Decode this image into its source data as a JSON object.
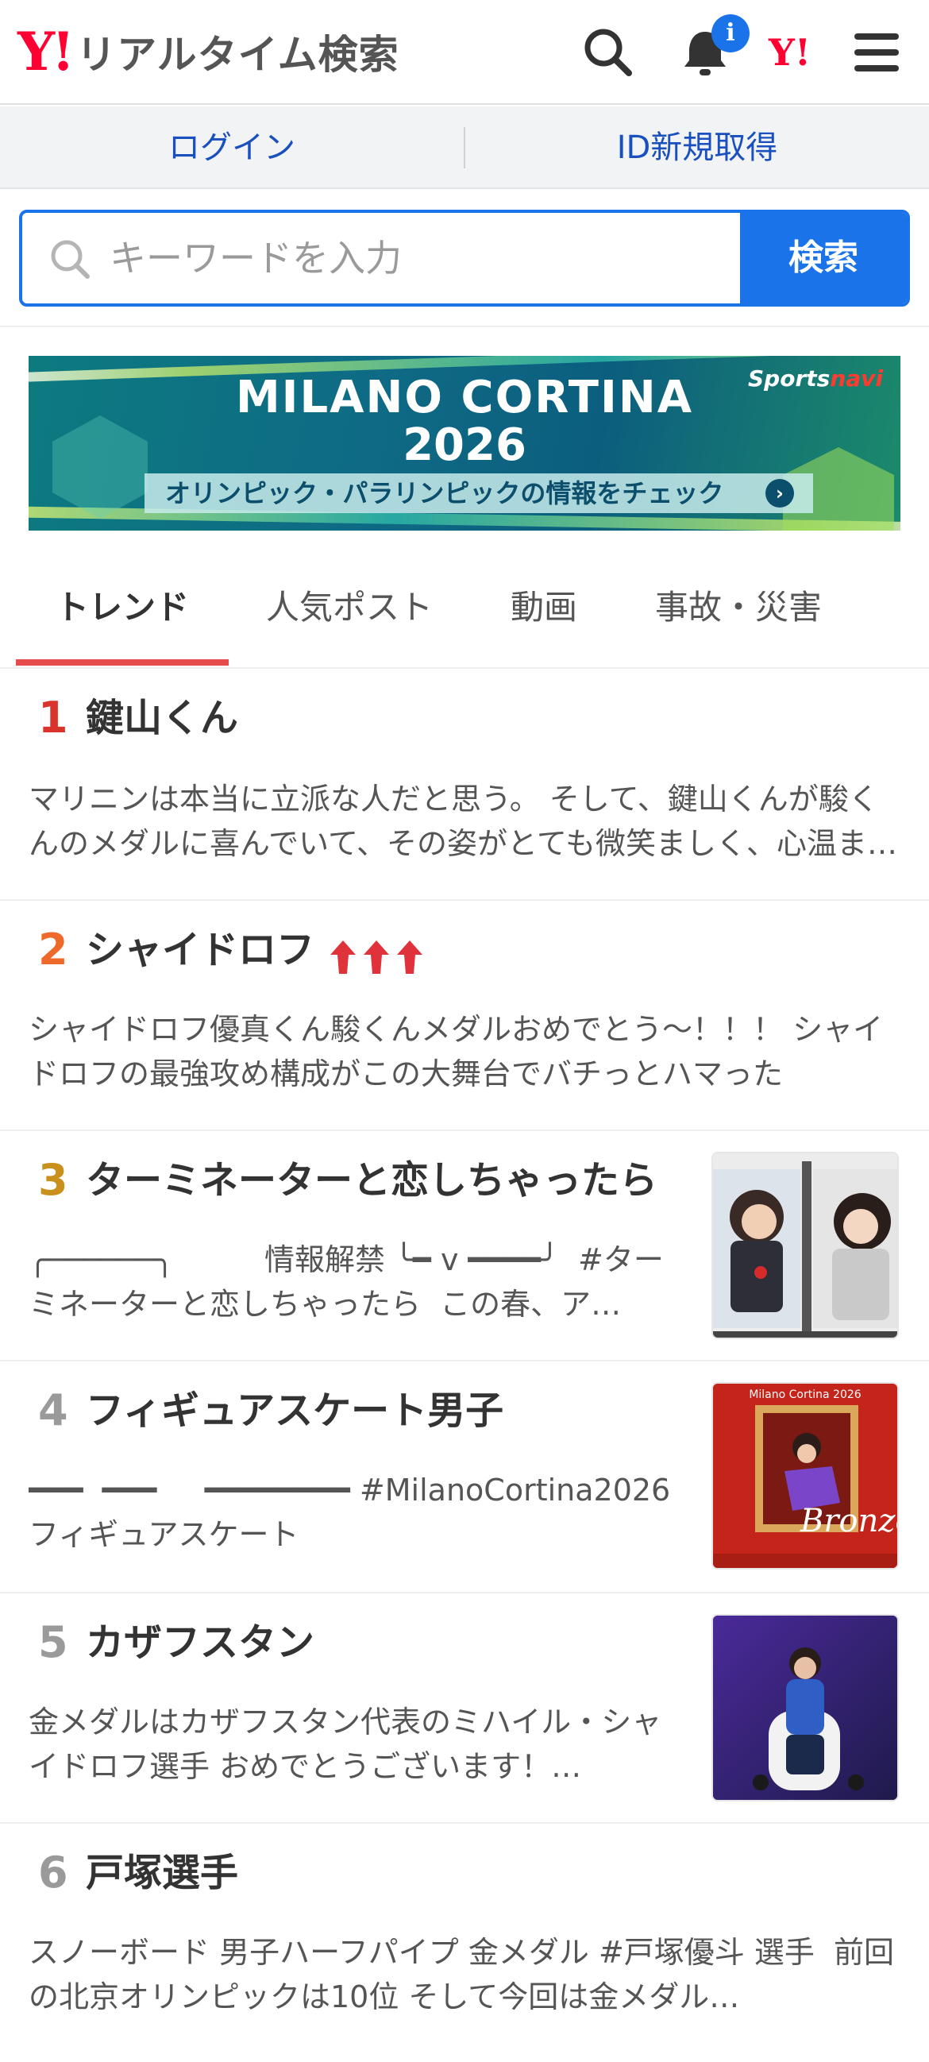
{
  "header": {
    "logo_mark": "Y!",
    "logo_text": "リアルタイム検索",
    "notification_badge": "i",
    "yj_logo": "Y!"
  },
  "loginbar": {
    "login_label": "ログイン",
    "signup_label": "ID新規取得"
  },
  "search": {
    "placeholder": "キーワードを入力",
    "button_label": "検索"
  },
  "banner": {
    "title": "MILANO CORTINA",
    "year": "2026",
    "cta": "オリンピック・パラリンピックの情報をチェック",
    "sponsor_a": "Sports",
    "sponsor_b": "navi"
  },
  "tabs": [
    {
      "label": "トレンド",
      "active": true
    },
    {
      "label": "人気ポスト",
      "active": false
    },
    {
      "label": "動画",
      "active": false
    },
    {
      "label": "事故・災害",
      "active": false
    }
  ],
  "colors": {
    "accent_blue": "#1a73e8",
    "rank1": "#d9342b",
    "rank2": "#ee6a2b",
    "rank3": "#c9901c",
    "rank_other": "#9a9a9a",
    "tab_underline": "#e74c4c"
  },
  "trends": [
    {
      "rank": "1",
      "title": "鍵山くん",
      "desc": "マリニンは本当に立派な人だと思う。 そして、鍵山くんが駿くんのメダルに喜んでいて、その姿がとても微笑ましく、心温まる光景でした。",
      "has_thumb": false
    },
    {
      "rank": "2",
      "title": "シャイドロフ",
      "desc": "シャイドロフ󠄀優真くん󠄀駿くん󠄀メダルおめでとう〜！！！ シャイドロフの最強攻め構成がこの大舞台でバチっとハマった",
      "has_thumb": false,
      "trend_arrows": 3
    },
    {
      "rank": "3",
      "title": "ターミネーターと恋しちゃったら",
      "desc": "╭──────╮　　　情報解禁 ╰━ v ━━━━╯ 󠄀 #ターミネーターと恋しちゃったら 󠄀 この春、ア…",
      "has_thumb": true
    },
    {
      "rank": "4",
      "title": "フィギュアスケート男子",
      "desc": "━━━ 󠄀󠄀 ━━━ 󠄀 󠄀󠄀󠄀󠄀󠄀󠄀󠄀 󠄀󠄀󠄀󠄀󠄀󠄀 󠄀 ━━━━━━━━ #MilanoCortina2026 フィギュアスケート",
      "has_thumb": true,
      "thumb_caption": "Bronze",
      "thumb_header": "Milano Cortina 2026"
    },
    {
      "rank": "5",
      "title": "カザフスタン",
      "desc": "金メダルはカザフスタン代表のミハイル・シャイドロフ選手󠄀 おめでとうございます！…",
      "has_thumb": true
    },
    {
      "rank": "6",
      "title": "戸塚選手",
      "desc": "スノーボード 男子ハーフパイプ 金メダル󠄀 #戸塚優斗 選手 󠄀 前回の北京オリンピックは10位 そして今回は金メダル…",
      "has_thumb": false
    }
  ]
}
